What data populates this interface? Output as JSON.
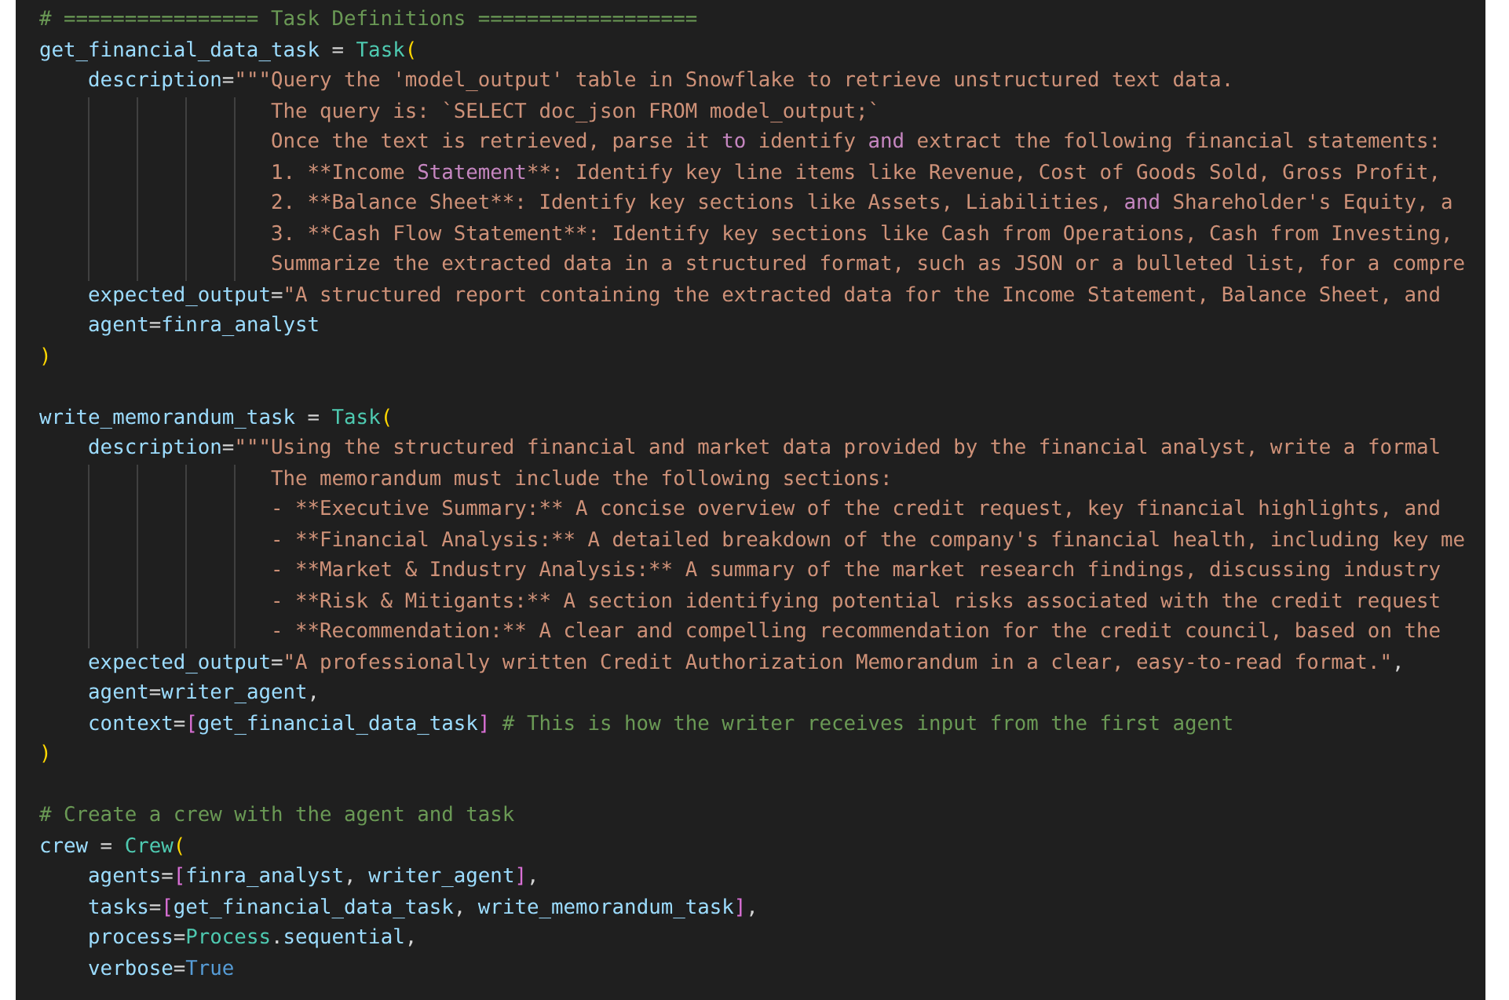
{
  "editor": {
    "lines": [
      {
        "kind": "code",
        "segments": [
          {
            "kind": "comment",
            "text": "# ================ Task Definitions =================="
          }
        ]
      },
      {
        "kind": "code",
        "segments": [
          {
            "kind": "var",
            "text": "get_financial_data_task"
          },
          {
            "kind": "op",
            "text": " = "
          },
          {
            "kind": "cls",
            "text": "Task"
          },
          {
            "kind": "paren",
            "text": "("
          }
        ]
      },
      {
        "kind": "code",
        "segments": [
          {
            "kind": "var",
            "text": "    description"
          },
          {
            "kind": "op",
            "text": "="
          },
          {
            "kind": "str",
            "text": "\"\"\"Query the 'model_output' table in Snowflake to retrieve unstructured text data."
          }
        ]
      },
      {
        "kind": "code",
        "segments": [
          {
            "kind": "str",
            "text": "                   The query is: `SELECT doc_json FROM model_output;`"
          }
        ]
      },
      {
        "kind": "code",
        "segments": [
          {
            "kind": "str",
            "text": "                   Once the text is retrieved, parse it "
          },
          {
            "kind": "kw",
            "text": "to"
          },
          {
            "kind": "str",
            "text": " identify "
          },
          {
            "kind": "kw",
            "text": "and"
          },
          {
            "kind": "str",
            "text": " extract the following financial statements:"
          }
        ]
      },
      {
        "kind": "code",
        "segments": [
          {
            "kind": "str",
            "text": "                   1. **Income "
          },
          {
            "kind": "kw",
            "text": "Statement"
          },
          {
            "kind": "str",
            "text": "**: Identify key line items like Revenue, Cost of Goods Sold, Gross Profit,"
          }
        ]
      },
      {
        "kind": "code",
        "segments": [
          {
            "kind": "str",
            "text": "                   2. **Balance Sheet**: Identify key sections like Assets, Liabilities, "
          },
          {
            "kind": "kw",
            "text": "and"
          },
          {
            "kind": "str",
            "text": " Shareholder's Equity, a"
          }
        ]
      },
      {
        "kind": "code",
        "segments": [
          {
            "kind": "str",
            "text": "                   3. **Cash Flow Statement**: Identify key sections like Cash from Operations, Cash from Investing,"
          }
        ]
      },
      {
        "kind": "code",
        "segments": [
          {
            "kind": "str",
            "text": "                   Summarize the extracted data in a structured format, such as JSON or a bulleted list, for a compre"
          }
        ]
      },
      {
        "kind": "code",
        "segments": [
          {
            "kind": "var",
            "text": "    expected_output"
          },
          {
            "kind": "op",
            "text": "="
          },
          {
            "kind": "str",
            "text": "\"A structured report containing the extracted data for the Income Statement, Balance Sheet, and"
          }
        ]
      },
      {
        "kind": "code",
        "segments": [
          {
            "kind": "var",
            "text": "    agent"
          },
          {
            "kind": "op",
            "text": "="
          },
          {
            "kind": "var",
            "text": "finra_analyst"
          }
        ]
      },
      {
        "kind": "code",
        "segments": [
          {
            "kind": "paren",
            "text": ")"
          }
        ]
      },
      {
        "kind": "blank"
      },
      {
        "kind": "code",
        "segments": [
          {
            "kind": "var",
            "text": "write_memorandum_task"
          },
          {
            "kind": "op",
            "text": " = "
          },
          {
            "kind": "cls",
            "text": "Task"
          },
          {
            "kind": "paren",
            "text": "("
          }
        ]
      },
      {
        "kind": "code",
        "segments": [
          {
            "kind": "var",
            "text": "    description"
          },
          {
            "kind": "op",
            "text": "="
          },
          {
            "kind": "str",
            "text": "\"\"\"Using the structured financial and market data provided by the financial analyst, write a formal"
          }
        ]
      },
      {
        "kind": "code",
        "segments": [
          {
            "kind": "str",
            "text": "                   The memorandum must include the following sections:"
          }
        ]
      },
      {
        "kind": "code",
        "segments": [
          {
            "kind": "str",
            "text": "                   - **Executive Summary:** A concise overview of the credit request, key financial highlights, and"
          }
        ]
      },
      {
        "kind": "code",
        "segments": [
          {
            "kind": "str",
            "text": "                   - **Financial Analysis:** A detailed breakdown of the company's financial health, including key me"
          }
        ]
      },
      {
        "kind": "code",
        "segments": [
          {
            "kind": "str",
            "text": "                   - **Market & Industry Analysis:** A summary of the market research findings, discussing industry"
          }
        ]
      },
      {
        "kind": "code",
        "segments": [
          {
            "kind": "str",
            "text": "                   - **Risk & Mitigants:** A section identifying potential risks associated with the credit request"
          }
        ]
      },
      {
        "kind": "code",
        "segments": [
          {
            "kind": "str",
            "text": "                   - **Recommendation:** A clear and compelling recommendation for the credit council, based on the"
          }
        ]
      },
      {
        "kind": "code",
        "segments": [
          {
            "kind": "var",
            "text": "    expected_output"
          },
          {
            "kind": "op",
            "text": "="
          },
          {
            "kind": "str",
            "text": "\"A professionally written Credit Authorization Memorandum in a clear, easy-to-read format.\""
          },
          {
            "kind": "op",
            "text": ","
          }
        ]
      },
      {
        "kind": "code",
        "segments": [
          {
            "kind": "var",
            "text": "    agent"
          },
          {
            "kind": "op",
            "text": "="
          },
          {
            "kind": "var",
            "text": "writer_agent"
          },
          {
            "kind": "op",
            "text": ","
          }
        ]
      },
      {
        "kind": "code",
        "segments": [
          {
            "kind": "var",
            "text": "    context"
          },
          {
            "kind": "op",
            "text": "="
          },
          {
            "kind": "bracket",
            "text": "["
          },
          {
            "kind": "var",
            "text": "get_financial_data_task"
          },
          {
            "kind": "bracket",
            "text": "]"
          },
          {
            "kind": "comment",
            "text": " # This is how the writer receives input from the first agent"
          }
        ]
      },
      {
        "kind": "code",
        "segments": [
          {
            "kind": "paren",
            "text": ")"
          }
        ]
      },
      {
        "kind": "blank"
      },
      {
        "kind": "code",
        "segments": [
          {
            "kind": "comment",
            "text": "# Create a crew with the agent and task"
          }
        ]
      },
      {
        "kind": "code",
        "segments": [
          {
            "kind": "var",
            "text": "crew"
          },
          {
            "kind": "op",
            "text": " = "
          },
          {
            "kind": "cls",
            "text": "Crew"
          },
          {
            "kind": "paren",
            "text": "("
          }
        ]
      },
      {
        "kind": "code",
        "segments": [
          {
            "kind": "var",
            "text": "    agents"
          },
          {
            "kind": "op",
            "text": "="
          },
          {
            "kind": "bracket",
            "text": "["
          },
          {
            "kind": "var",
            "text": "finra_analyst"
          },
          {
            "kind": "op",
            "text": ", "
          },
          {
            "kind": "var",
            "text": "writer_agent"
          },
          {
            "kind": "bracket",
            "text": "]"
          },
          {
            "kind": "op",
            "text": ","
          }
        ]
      },
      {
        "kind": "code",
        "segments": [
          {
            "kind": "var",
            "text": "    tasks"
          },
          {
            "kind": "op",
            "text": "="
          },
          {
            "kind": "bracket",
            "text": "["
          },
          {
            "kind": "var",
            "text": "get_financial_data_task"
          },
          {
            "kind": "op",
            "text": ", "
          },
          {
            "kind": "var",
            "text": "write_memorandum_task"
          },
          {
            "kind": "bracket",
            "text": "]"
          },
          {
            "kind": "op",
            "text": ","
          }
        ]
      },
      {
        "kind": "code",
        "segments": [
          {
            "kind": "var",
            "text": "    process"
          },
          {
            "kind": "op",
            "text": "="
          },
          {
            "kind": "cls",
            "text": "Process"
          },
          {
            "kind": "op",
            "text": "."
          },
          {
            "kind": "var",
            "text": "sequential"
          },
          {
            "kind": "op",
            "text": ","
          }
        ]
      },
      {
        "kind": "code",
        "segments": [
          {
            "kind": "var",
            "text": "    verbose"
          },
          {
            "kind": "op",
            "text": "="
          },
          {
            "kind": "const",
            "text": "True"
          }
        ]
      }
    ]
  }
}
